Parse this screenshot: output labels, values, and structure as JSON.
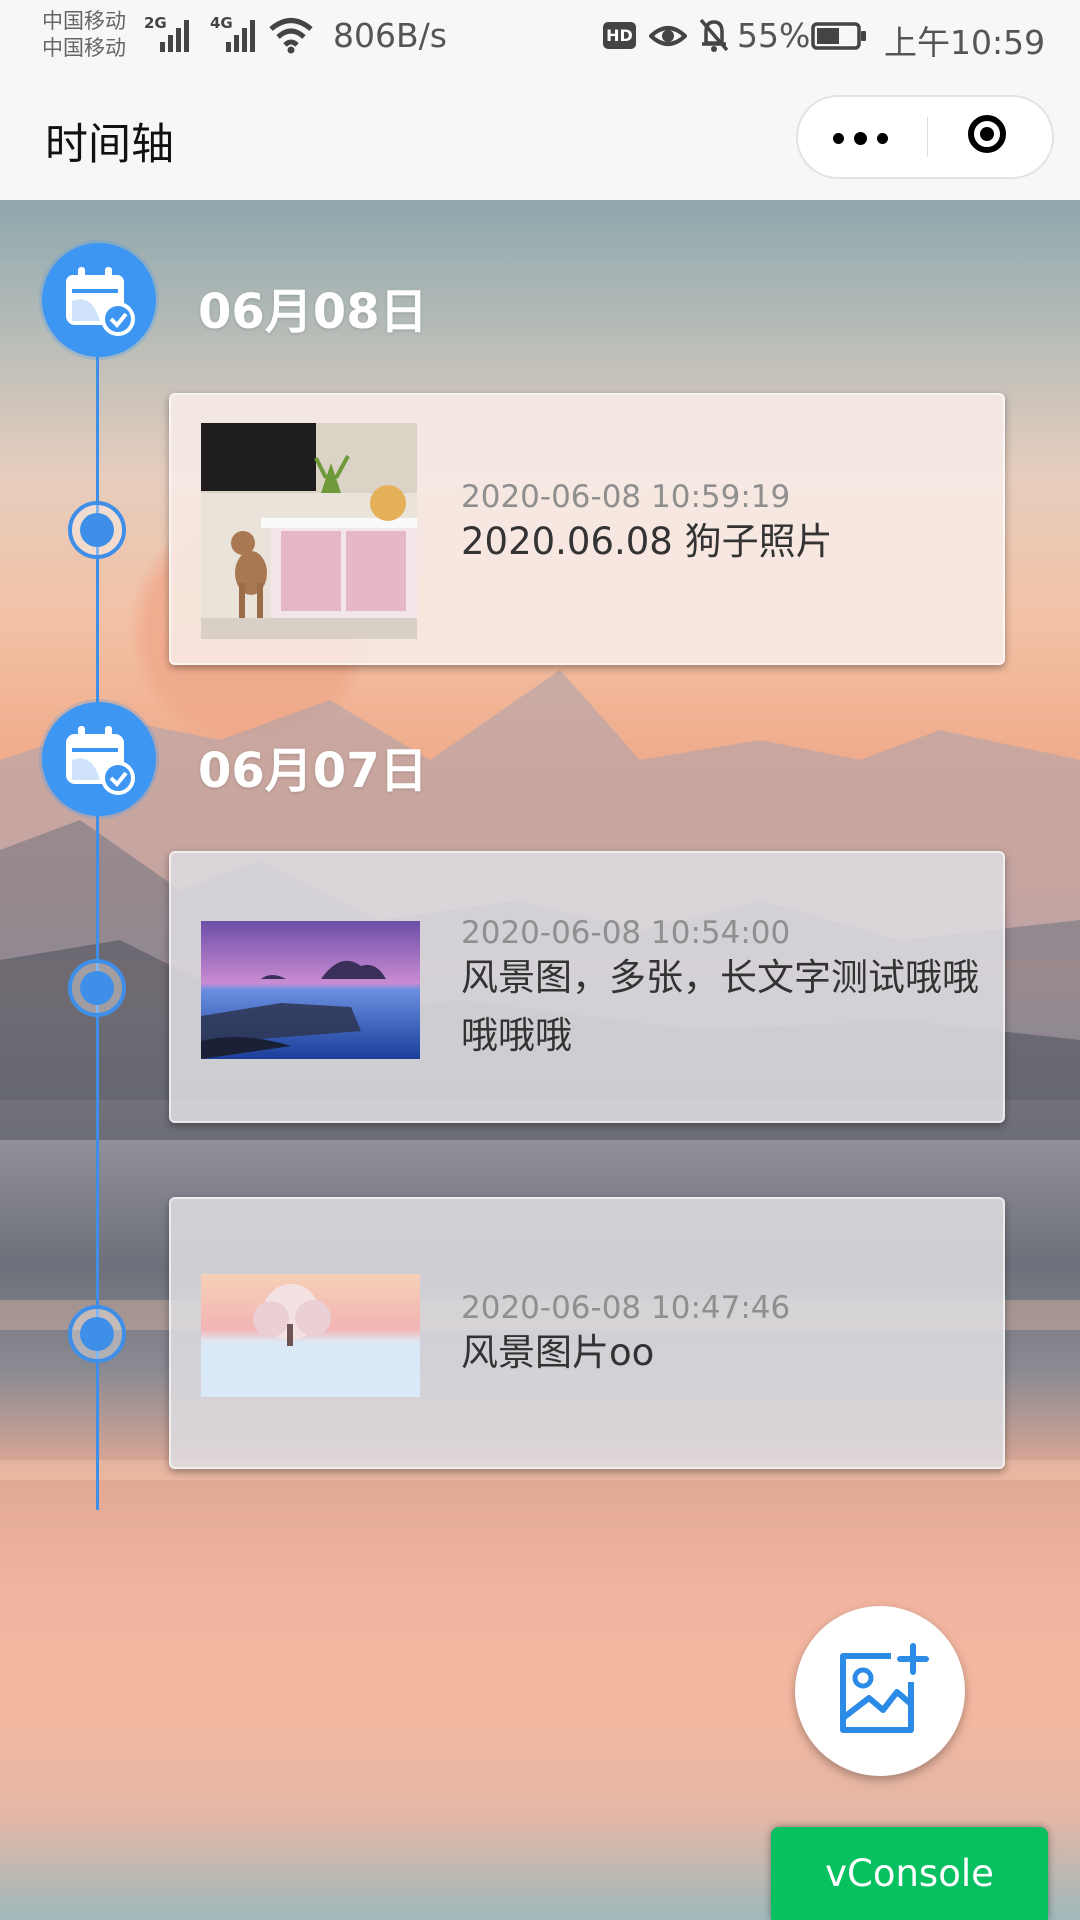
{
  "status_bar": {
    "carrier_1": "中国移动",
    "carrier_2": "中国移动",
    "net_1": "2G",
    "net_2": "4G",
    "speed": "806B/s",
    "hd": "HD",
    "battery_pct": "55%",
    "clock": "上午10:59"
  },
  "nav": {
    "title": "时间轴"
  },
  "timeline": {
    "groups": [
      {
        "date": "06月08日"
      },
      {
        "date": "06月07日"
      }
    ],
    "entries": [
      {
        "time": "2020-06-08 10:59:19",
        "text": "2020.06.08 狗子照片",
        "image": "dog-photo"
      },
      {
        "time": "2020-06-08 10:54:00",
        "text": "风景图，多张，长文字测试哦哦哦哦哦",
        "image": "landscape-lake-photo"
      },
      {
        "time": "2020-06-08 10:47:46",
        "text": "风景图片oo",
        "image": "snow-tree-photo"
      }
    ]
  },
  "fab": {
    "icon": "add-image-icon"
  },
  "vconsole": {
    "label": "vConsole"
  },
  "colors": {
    "accent": "#3d96f2",
    "vconsole": "#07c160"
  }
}
